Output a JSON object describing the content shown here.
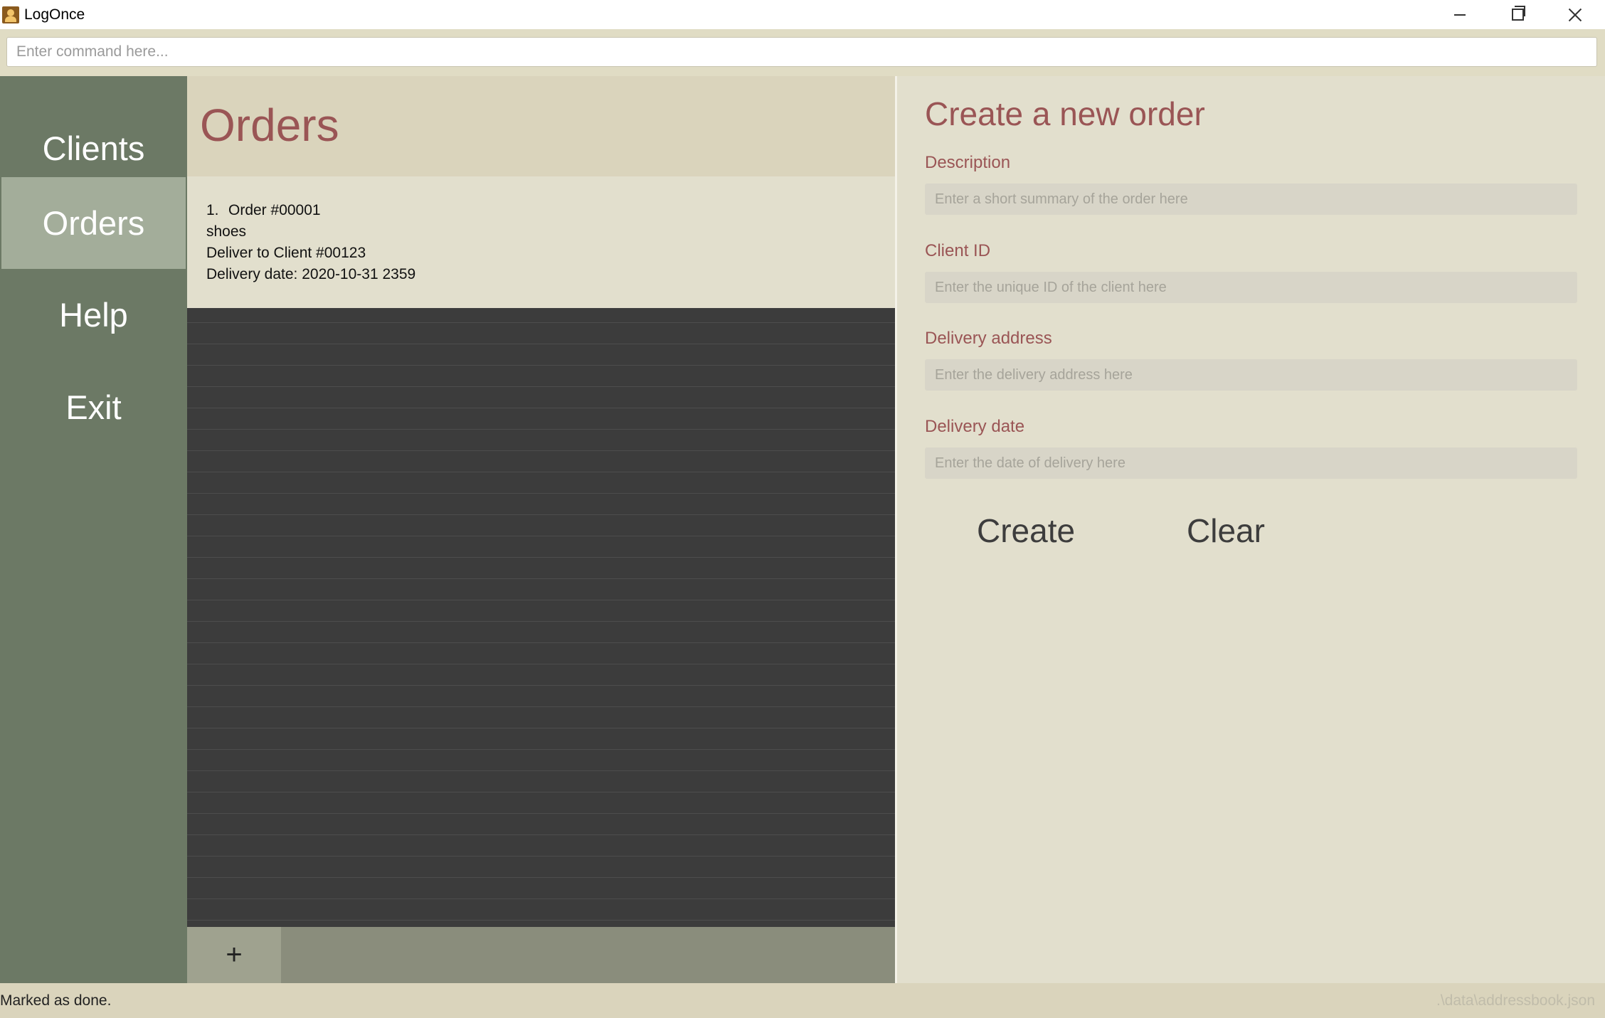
{
  "window": {
    "title": "LogOnce",
    "controls": {
      "minimize": "minimize",
      "maximize": "restore",
      "close": "close"
    }
  },
  "command": {
    "placeholder": "Enter command here..."
  },
  "sidebar": {
    "items": [
      {
        "label": "Clients",
        "active": false
      },
      {
        "label": "Orders",
        "active": true
      },
      {
        "label": "Help",
        "active": false
      },
      {
        "label": "Exit",
        "active": false
      }
    ]
  },
  "orders": {
    "title": "Orders",
    "list": [
      {
        "index": "1.",
        "order_id": "Order #00001",
        "description": "shoes",
        "client": "Deliver to Client #00123",
        "delivery_date": "Delivery date: 2020-10-31 2359"
      }
    ],
    "add_label": "+"
  },
  "form": {
    "title": "Create a new order",
    "fields": [
      {
        "label": "Description",
        "placeholder": "Enter a short summary of the order here"
      },
      {
        "label": "Client ID",
        "placeholder": "Enter the unique ID of the client here"
      },
      {
        "label": "Delivery address",
        "placeholder": "Enter the delivery address here"
      },
      {
        "label": "Delivery date",
        "placeholder": "Enter the date of delivery here"
      }
    ],
    "create_label": "Create",
    "clear_label": "Clear"
  },
  "status": {
    "message": "Marked as done.",
    "file_path": ".\\data\\addressbook.json"
  },
  "colors": {
    "sidebar": "#6c7965",
    "sidebar_active": "#a3ad9a",
    "accent_text": "#9a5555",
    "panel_bg": "#e2dfcd",
    "header_bg": "#dad4bc",
    "list_bg": "#3c3c3c"
  }
}
